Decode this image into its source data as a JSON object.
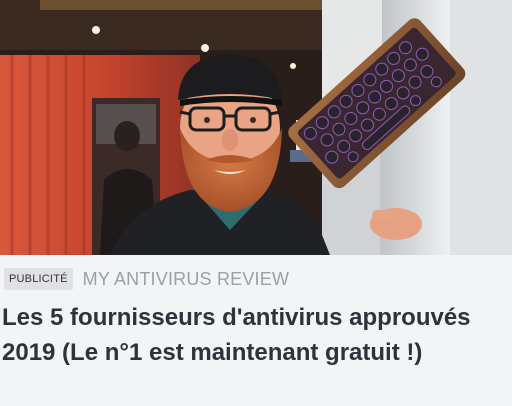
{
  "ad": {
    "badge": "PUBLICITÉ",
    "source": "MY ANTIVIRUS REVIEW",
    "headline": "Les 5 fournisseurs d'antivirus approuvés 2019 (Le n°1 est maintenant gratuit !)"
  },
  "image": {
    "subject": "photo",
    "colors": {
      "background_red": "#c8452e",
      "wall_dark": "#2a1e1b",
      "right_panel": "#d8dcde",
      "beard": "#c96a36",
      "skin": "#e8a484",
      "cap": "#1c1c1e",
      "jacket": "#1f2124",
      "keyboard_wood": "#8a5a36",
      "key": "#2b2230"
    }
  },
  "theme": {
    "background": "#f3f4f6",
    "badge_bg": "#dfe1e6",
    "source_color": "#9aa0a8",
    "headline_color": "#2d333a"
  }
}
